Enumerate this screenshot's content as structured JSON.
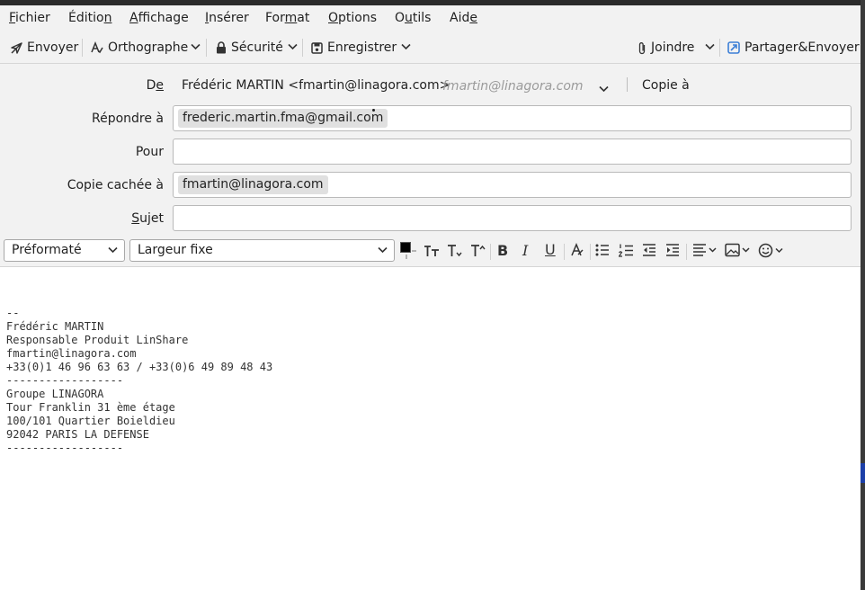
{
  "menubar": {
    "items": [
      {
        "pre": "",
        "acc": "F",
        "post": "ichier"
      },
      {
        "pre": "Éditio",
        "acc": "n",
        "post": ""
      },
      {
        "pre": "",
        "acc": "A",
        "post": "ffichage"
      },
      {
        "pre": "",
        "acc": "I",
        "post": "nsérer"
      },
      {
        "pre": "For",
        "acc": "m",
        "post": "at"
      },
      {
        "pre": "",
        "acc": "O",
        "post": "ptions"
      },
      {
        "pre": "O",
        "acc": "u",
        "post": "tils"
      },
      {
        "pre": "Aid",
        "acc": "e",
        "post": ""
      }
    ]
  },
  "toolbar": {
    "send_label": "Envoyer",
    "spell_label": "Orthographe",
    "security_label": "Sécurité",
    "save_label": "Enregistrer",
    "attach_label": "Joindre",
    "share_label": "Partager&Envoyer"
  },
  "header": {
    "from_label_pre": "D",
    "from_label_acc": "e",
    "from_value": "Frédéric MARTIN <fmartin@linagora.com>",
    "from_identity": "fmartin@linagora.com",
    "cc_link": "Copie à",
    "reply_to_label": "Répondre à",
    "reply_to_pill": "frederic.martin.fma@gmail.com",
    "to_label": "Pour",
    "bcc_label": "Copie cachée à",
    "bcc_pill": "fmartin@linagora.com",
    "subject_label_acc": "S",
    "subject_label_post": "ujet"
  },
  "format": {
    "paragraph_style": "Préformaté",
    "font": "Largeur fixe"
  },
  "body": {
    "signature": [
      "--",
      "Frédéric MARTIN",
      "Responsable Produit LinShare",
      "fmartin@linagora.com",
      "+33(0)1 46 96 63 63 / +33(0)6 49 89 48 43",
      "------------------",
      "Groupe LINAGORA",
      "Tour Franklin 31 ème étage",
      "100/101 Quartier Boieldieu",
      "92042 PARIS LA DEFENSE",
      "------------------"
    ]
  },
  "colors": {
    "text_color_swatch": "#000000",
    "share_icon": "#3c7fd6"
  }
}
